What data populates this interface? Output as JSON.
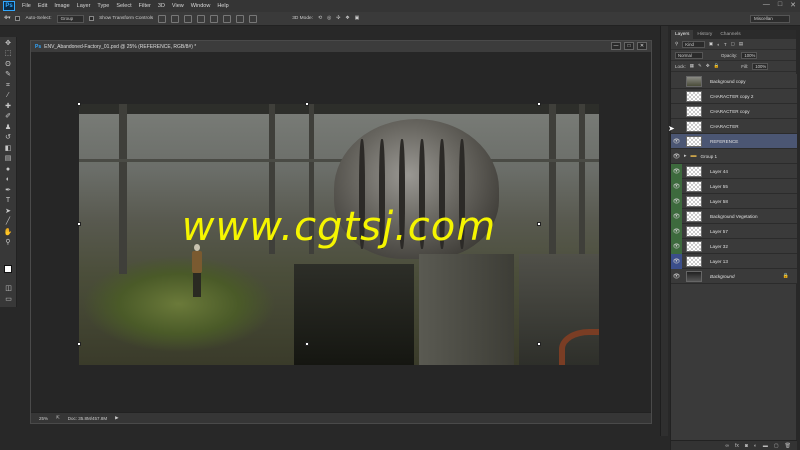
{
  "app": {
    "logo": "Ps",
    "menu": [
      "File",
      "Edit",
      "Image",
      "Layer",
      "Type",
      "Select",
      "Filter",
      "3D",
      "View",
      "Window",
      "Help"
    ],
    "window_controls": [
      "—",
      "□",
      "✕"
    ]
  },
  "options_bar": {
    "auto_select_label": "Auto-Select:",
    "auto_select_target": "Group",
    "show_transform_label": "Show Transform Controls",
    "mode_label": "3D Mode:",
    "workspace": "Miscellan"
  },
  "document": {
    "title": "ENV_Abandoned-Factory_01.psd @ 25% (REFERENCE, RGB/8#) *",
    "window_controls": [
      "—",
      "□",
      "✕"
    ],
    "watermark": "www.cgtsj.com",
    "zoom": "25%",
    "doc_size": "Doc: 35.8M/457.8M"
  },
  "layers_panel": {
    "tabs": [
      "Layers",
      "History",
      "Channels"
    ],
    "filter_kind": "Kind",
    "blend_mode": "Normal",
    "opacity_label": "Opacity:",
    "opacity_value": "100%",
    "lock_label": "Lock:",
    "fill_label": "Fill:",
    "fill_value": "100%",
    "layers": [
      {
        "name": "Background copy",
        "eye": "none",
        "thumb": "photo",
        "type": "layer"
      },
      {
        "name": "CHARACTER copy 2",
        "eye": "none",
        "thumb": "checker",
        "type": "layer"
      },
      {
        "name": "CHARACTER copy",
        "eye": "none",
        "thumb": "checker",
        "type": "layer"
      },
      {
        "name": "CHARACTER",
        "eye": "none",
        "thumb": "checker",
        "type": "layer"
      },
      {
        "name": "REFERENCE",
        "eye": "plain",
        "thumb": "checker",
        "type": "layer",
        "selected": true
      },
      {
        "name": "Group 1",
        "eye": "plain",
        "thumb": "folder",
        "type": "group"
      },
      {
        "name": "Layer 44",
        "eye": "green",
        "thumb": "checker",
        "type": "layer"
      },
      {
        "name": "Layer 55",
        "eye": "green",
        "thumb": "checker",
        "type": "layer"
      },
      {
        "name": "Layer 58",
        "eye": "green",
        "thumb": "checker",
        "type": "layer"
      },
      {
        "name": "Background Vegetation",
        "eye": "green",
        "thumb": "checker",
        "type": "layer"
      },
      {
        "name": "Layer 57",
        "eye": "green",
        "thumb": "checker",
        "type": "layer"
      },
      {
        "name": "Layer 32",
        "eye": "green",
        "thumb": "checker",
        "type": "layer"
      },
      {
        "name": "Layer 13",
        "eye": "blue",
        "thumb": "checker",
        "type": "layer"
      },
      {
        "name": "Background",
        "eye": "plain",
        "thumb": "dark",
        "type": "layer",
        "locked": true,
        "italic": true
      }
    ],
    "footer_icons": [
      "link-icon",
      "fx-icon",
      "mask-icon",
      "adjustment-icon",
      "folder-icon",
      "new-layer-icon",
      "trash-icon"
    ]
  },
  "colors": {
    "accent_selected": "#4b5673",
    "eye_green": "#3d6a3d",
    "eye_blue": "#3b4e8a",
    "watermark": "#f5f500"
  }
}
